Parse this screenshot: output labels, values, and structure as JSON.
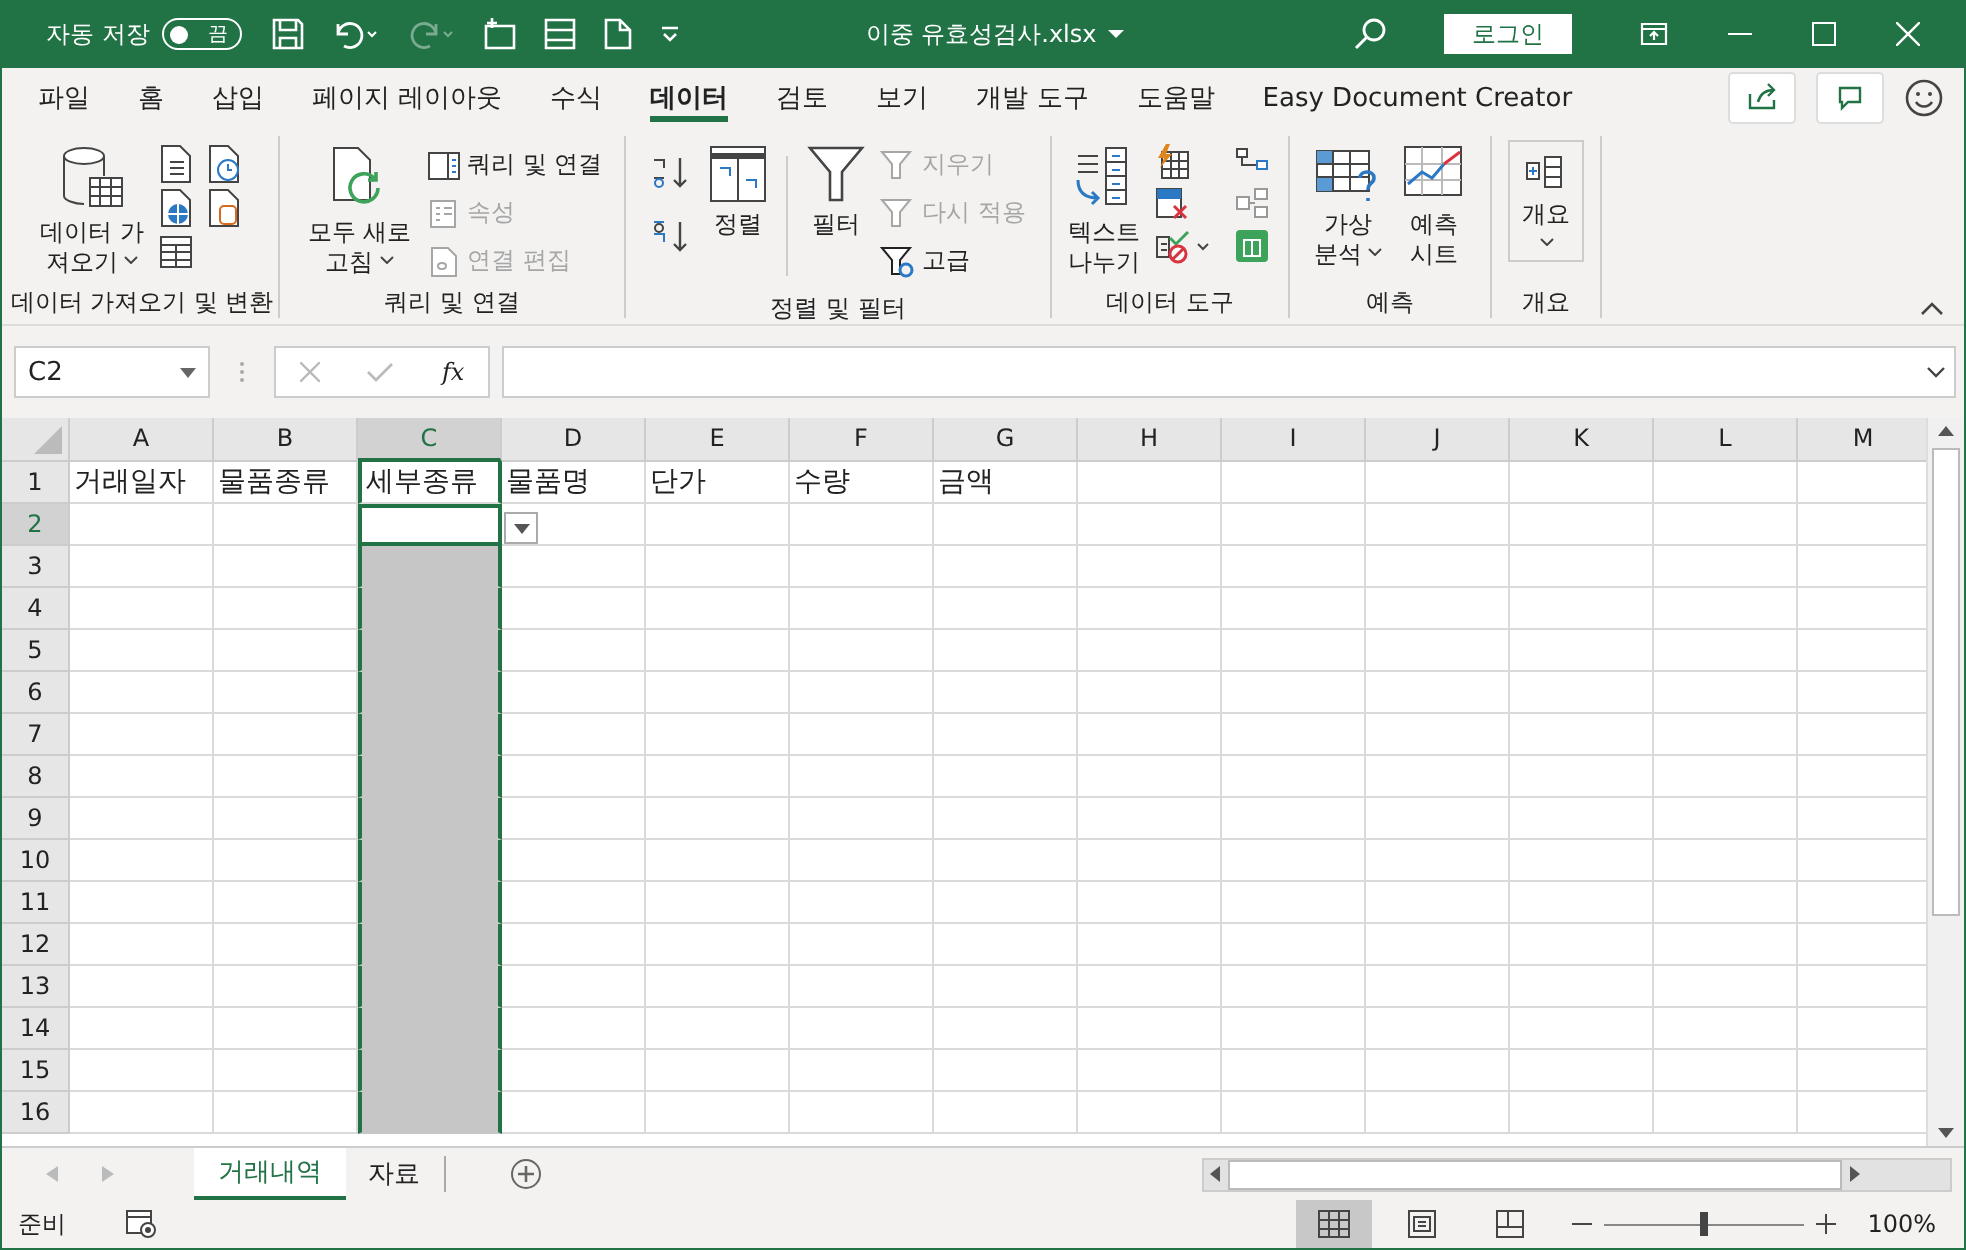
{
  "title_bar": {
    "autosave_label": "자동 저장",
    "autosave": {
      "on": false,
      "label": "끔"
    },
    "redo_disabled": true,
    "title": "이중 유효성검사.xlsx",
    "login": "로그인"
  },
  "tabs": [
    {
      "label": "파일",
      "selected": false
    },
    {
      "label": "홈",
      "selected": false
    },
    {
      "label": "삽입",
      "selected": false
    },
    {
      "label": "페이지 레이아웃",
      "selected": false
    },
    {
      "label": "수식",
      "selected": false
    },
    {
      "label": "데이터",
      "selected": true
    },
    {
      "label": "검토",
      "selected": false
    },
    {
      "label": "보기",
      "selected": false
    },
    {
      "label": "개발 도구",
      "selected": false
    },
    {
      "label": "도움말",
      "selected": false
    },
    {
      "label": "Easy Document Creator",
      "selected": false
    }
  ],
  "ribbon": {
    "groups": [
      {
        "label": "데이터 가져오기 및 변환",
        "items": [
          {
            "lines": [
              "데이터 가",
              "져오기"
            ]
          }
        ]
      },
      {
        "label": "쿼리 및 연결",
        "items": [
          {
            "lines": [
              "모두 새로",
              "고침"
            ]
          },
          {
            "lines": [
              "쿼리 및 연결"
            ],
            "disabled": false
          },
          {
            "lines": [
              "속성"
            ],
            "disabled": true
          },
          {
            "lines": [
              "연결 편집"
            ],
            "disabled": true
          }
        ]
      },
      {
        "label": "정렬 및 필터",
        "items": [
          {
            "lines": [
              "정렬"
            ]
          },
          {
            "lines": [
              "필터"
            ]
          },
          {
            "lines": [
              "지우기"
            ],
            "disabled": true
          },
          {
            "lines": [
              "다시 적용"
            ],
            "disabled": true
          },
          {
            "lines": [
              "고급"
            ],
            "disabled": false
          }
        ]
      },
      {
        "label": "데이터 도구",
        "items": [
          {
            "lines": [
              "텍스트",
              "나누기"
            ]
          }
        ]
      },
      {
        "label": "예측",
        "items": [
          {
            "lines": [
              "가상",
              "분석"
            ]
          },
          {
            "lines": [
              "예측",
              "시트"
            ]
          }
        ]
      },
      {
        "label": "개요",
        "items": [
          {
            "lines": [
              "개요"
            ]
          }
        ]
      }
    ]
  },
  "formula_bar": {
    "name_box": "C2",
    "fx": "fx"
  },
  "grid": {
    "columns": [
      {
        "label": "A",
        "selected": false
      },
      {
        "label": "B",
        "selected": false
      },
      {
        "label": "C",
        "selected": true
      },
      {
        "label": "D",
        "selected": false
      },
      {
        "label": "E",
        "selected": false
      },
      {
        "label": "F",
        "selected": false
      },
      {
        "label": "G",
        "selected": false
      },
      {
        "label": "H",
        "selected": false
      },
      {
        "label": "I",
        "selected": false
      },
      {
        "label": "J",
        "selected": false
      },
      {
        "label": "K",
        "selected": false
      },
      {
        "label": "L",
        "selected": false
      },
      {
        "label": "M",
        "selected": false
      }
    ],
    "rows": [
      {
        "number": "1",
        "active": false,
        "cells": [
          "거래일자",
          "물품종류",
          "세부종류",
          "물품명",
          "단가",
          "수량",
          "금액"
        ]
      },
      {
        "number": "2",
        "active": true
      },
      {
        "number": "3",
        "active": false
      },
      {
        "number": "4",
        "active": false
      },
      {
        "number": "5",
        "active": false
      },
      {
        "number": "6",
        "active": false
      },
      {
        "number": "7",
        "active": false
      },
      {
        "number": "8",
        "active": false
      },
      {
        "number": "9",
        "active": false
      },
      {
        "number": "10",
        "active": false
      },
      {
        "number": "11",
        "active": false
      },
      {
        "number": "12",
        "active": false
      },
      {
        "number": "13",
        "active": false
      },
      {
        "number": "14",
        "active": false
      },
      {
        "number": "15",
        "active": false
      },
      {
        "number": "16",
        "active": false
      }
    ]
  },
  "sheet_tabs": [
    {
      "label": "거래내역",
      "selected": true
    },
    {
      "label": "자료",
      "selected": false
    }
  ],
  "status_bar": {
    "status": "준비",
    "views": [
      {
        "selected": true
      },
      {
        "selected": false
      },
      {
        "selected": false
      }
    ],
    "level": 0.5,
    "zoom": "100%"
  }
}
